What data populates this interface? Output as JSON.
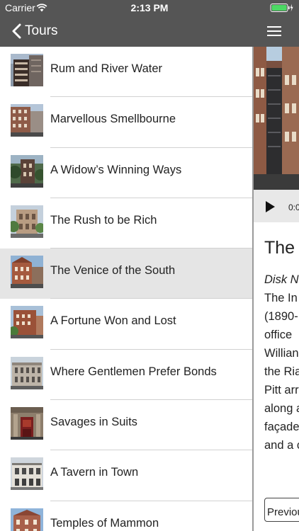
{
  "status_bar": {
    "carrier": "Carrier",
    "time": "2:13 PM"
  },
  "nav": {
    "back_label": "Tours"
  },
  "tours": [
    {
      "title": "Rum and River Water"
    },
    {
      "title": "Marvellous Smellbourne"
    },
    {
      "title": "A Widow’s Winning Ways"
    },
    {
      "title": "The Rush to be Rich"
    },
    {
      "title": "The Venice of the South",
      "selected": true
    },
    {
      "title": "A Fortune Won and Lost"
    },
    {
      "title": "Where Gentlemen Prefer Bonds"
    },
    {
      "title": "Savages in Suits"
    },
    {
      "title": "A Tavern in Town"
    },
    {
      "title": "Temples of Mammon"
    }
  ],
  "detail": {
    "player_time": "0:0",
    "title": "The V",
    "subtitle": "Disk N",
    "description_lines": [
      "The In",
      "(1890-",
      "office",
      "Willian",
      "the Ria",
      "Pitt arr",
      "along a",
      "façade",
      "and a c"
    ],
    "prev_label": "Previou"
  }
}
